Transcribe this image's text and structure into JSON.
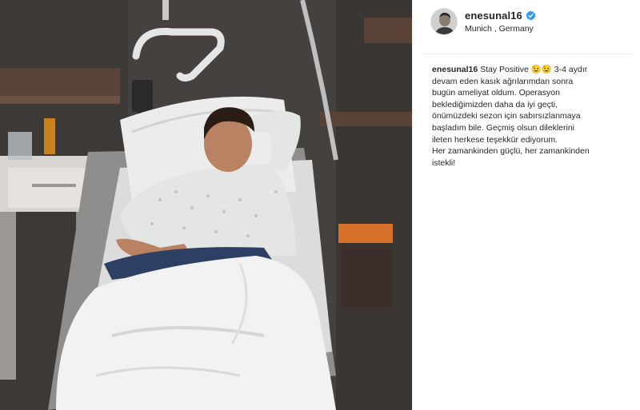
{
  "post": {
    "author": {
      "username": "enesunal16",
      "verified": true,
      "location": "Munich , Germany"
    },
    "photo": {
      "icon": "hospital-bed-photo"
    },
    "caption": {
      "username": "enesunal16",
      "text": "Stay Positive 😉😉 3-4 aydır\ndevam eden kasık ağrılarımdan sonra\nbugün ameliyat oldum. Operasyon\nbeklediğimizden daha da iyi geçti,\nönümüzdeki sezon için sabırsızlanmaya\nbaşladım bile. Geçmiş olsun dileklerini\nileten herkese teşekkür ediyorum.\nHer zamankinden güçlü, her zamankinden\nistekli!"
    }
  },
  "colors": {
    "verified_badge": "#3897f0",
    "text": "#262626",
    "divider": "#efefef"
  }
}
